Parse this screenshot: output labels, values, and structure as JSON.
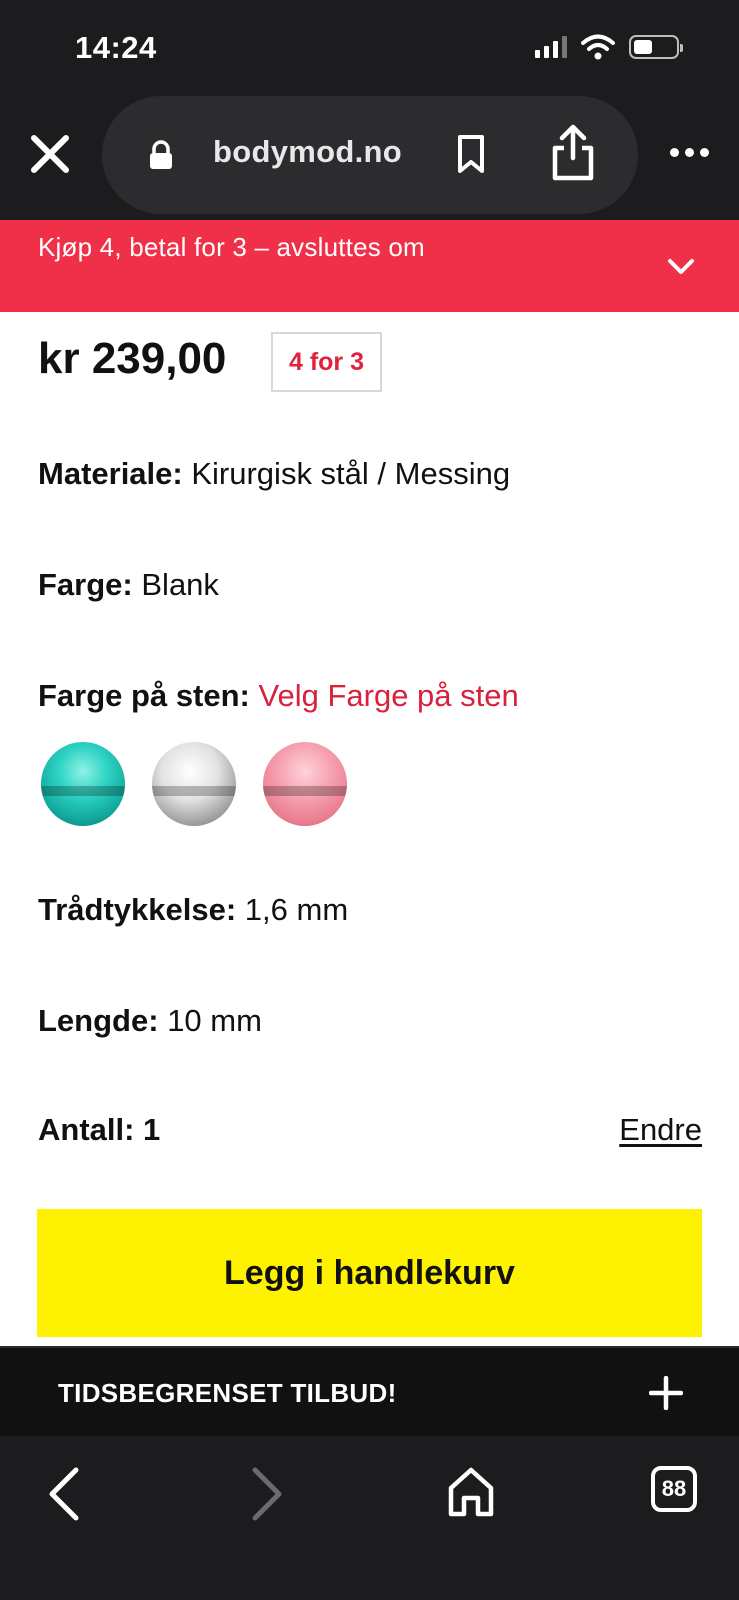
{
  "status_bar": {
    "time": "14:24"
  },
  "browser": {
    "url": "bodymod.no"
  },
  "promo": {
    "text": "Kjøp 4, betal for 3 – avsluttes om"
  },
  "product": {
    "price": "kr 239,00",
    "badge": "4 for 3",
    "material_label": "Materiale:",
    "material_value": "Kirurgisk stål / Messing",
    "color_label": "Farge:",
    "color_value": "Blank",
    "stone_color_label": "Farge på sten:",
    "stone_color_prompt": "Velg Farge på sten",
    "stone_options": [
      {
        "name": "teal",
        "color": "#2fd4c4"
      },
      {
        "name": "clear",
        "color": "#e2e2e2"
      },
      {
        "name": "pink",
        "color": "#f6a0b0"
      }
    ],
    "thickness_label": "Trådtykkelse:",
    "thickness_value": "1,6 mm",
    "length_label": "Lengde:",
    "length_value": "10 mm",
    "quantity_label": "Antall: 1",
    "quantity_change": "Endre",
    "add_to_cart": "Legg i handlekurv"
  },
  "offer_bar": {
    "text": "TIDSBEGRENSET TILBUD!"
  },
  "toolbar": {
    "tabs_count": "88"
  },
  "colors": {
    "promo_bg": "#f02f48",
    "accent_red": "#d8213b",
    "cta_yellow": "#fff200",
    "chrome_dark": "#1c1c1e"
  }
}
